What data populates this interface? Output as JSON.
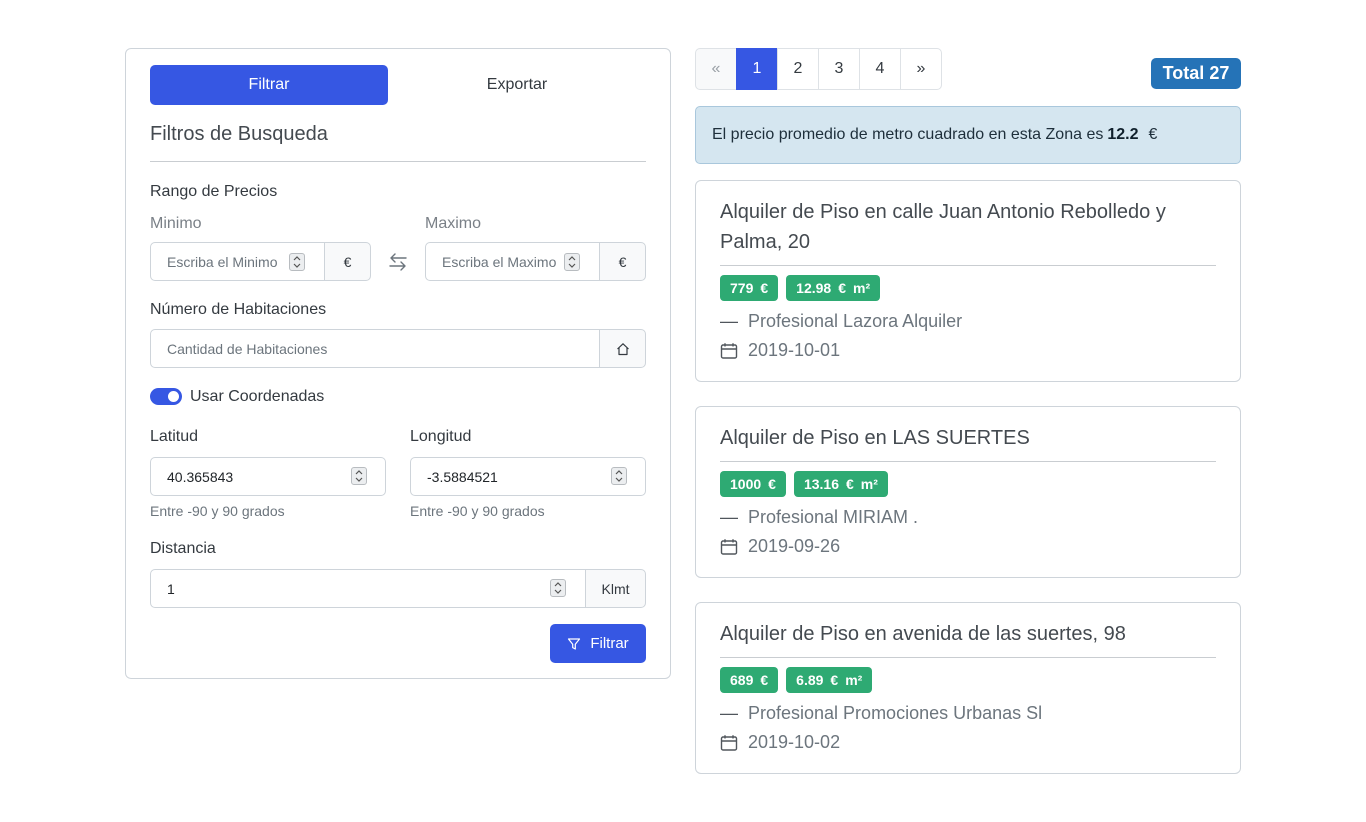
{
  "tabs": {
    "filter": "Filtrar",
    "export": "Exportar"
  },
  "filters": {
    "title": "Filtros de Busqueda",
    "price_range": {
      "label": "Rango de Precios",
      "min_label": "Minimo",
      "min_placeholder": "Escriba el Minimo",
      "max_label": "Maximo",
      "max_placeholder": "Escriba el Maximo",
      "currency": "€"
    },
    "rooms": {
      "label": "Número de Habitaciones",
      "placeholder": "Cantidad de Habitaciones"
    },
    "use_coords": {
      "label": "Usar Coordenadas",
      "checked": true
    },
    "latitude": {
      "label": "Latitud",
      "value": "40.365843",
      "help": "Entre -90 y 90 grados"
    },
    "longitude": {
      "label": "Longitud",
      "value": "-3.5884521",
      "help": "Entre -90 y 90 grados"
    },
    "distance": {
      "label": "Distancia",
      "value": "1",
      "unit": "Klmt"
    },
    "submit_label": "Filtrar"
  },
  "pagination": {
    "prev": "«",
    "pages": [
      "1",
      "2",
      "3",
      "4"
    ],
    "active": "1",
    "next": "»"
  },
  "total": {
    "label": "Total",
    "value": "27"
  },
  "alert": {
    "text": "El precio promedio de metro cuadrado en esta Zona es",
    "value": "12.2",
    "currency": "€"
  },
  "listings": [
    {
      "title": "Alquiler de Piso en calle Juan Antonio Rebolledo y Palma, 20",
      "price": "779",
      "price_m2": "12.98",
      "currency": "€",
      "unit": "m²",
      "agent_dash": "—",
      "agent": "Profesional Lazora Alquiler",
      "date": "2019-10-01"
    },
    {
      "title": "Alquiler de Piso en LAS SUERTES",
      "price": "1000",
      "price_m2": "13.16",
      "currency": "€",
      "unit": "m²",
      "agent_dash": "—",
      "agent": "Profesional MIRIAM .",
      "date": "2019-09-26"
    },
    {
      "title": "Alquiler de Piso en avenida de las suertes, 98",
      "price": "689",
      "price_m2": "6.89",
      "currency": "€",
      "unit": "m²",
      "agent_dash": "—",
      "agent": "Profesional Promociones Urbanas Sl",
      "date": "2019-10-02"
    }
  ],
  "colors": {
    "primary": "#3657e3",
    "success": "#2eaa73",
    "info_badge": "#2573b7",
    "alert_bg": "#d5e6f0"
  }
}
